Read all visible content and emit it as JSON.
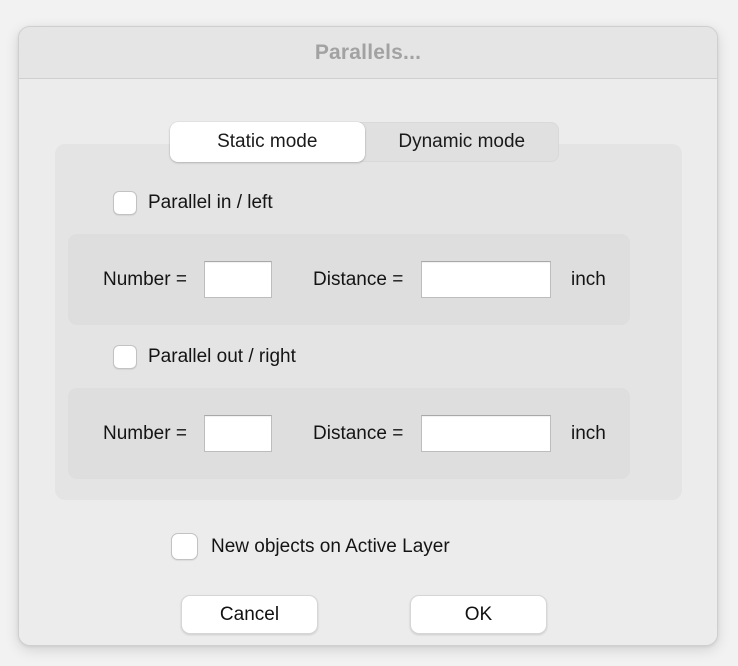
{
  "window": {
    "title": "Parallels..."
  },
  "tabs": [
    {
      "label": "Static mode",
      "active": true
    },
    {
      "label": "Dynamic mode",
      "active": false
    }
  ],
  "sections": [
    {
      "checkbox_label": "Parallel in / left",
      "checked": false,
      "number_label": "Number =",
      "number_value": "",
      "distance_label": "Distance =",
      "distance_value": "",
      "unit_label": "inch"
    },
    {
      "checkbox_label": "Parallel out / right",
      "checked": false,
      "number_label": "Number =",
      "number_value": "",
      "distance_label": "Distance =",
      "distance_value": "",
      "unit_label": "inch"
    }
  ],
  "options": {
    "new_objects_label": "New objects on Active Layer",
    "new_objects_checked": false
  },
  "buttons": {
    "cancel_label": "Cancel",
    "ok_label": "OK"
  },
  "colors": {
    "window_background": "#ececec",
    "titlebar_background": "#e5e5e5",
    "title_text": "#a2a2a2",
    "group_background": "#e4e4e4",
    "panel_background": "#dedede",
    "segmented_track": "#e0e0e0",
    "segmented_active": "#ffffff",
    "field_background": "#ffffff",
    "text": "#141414"
  }
}
